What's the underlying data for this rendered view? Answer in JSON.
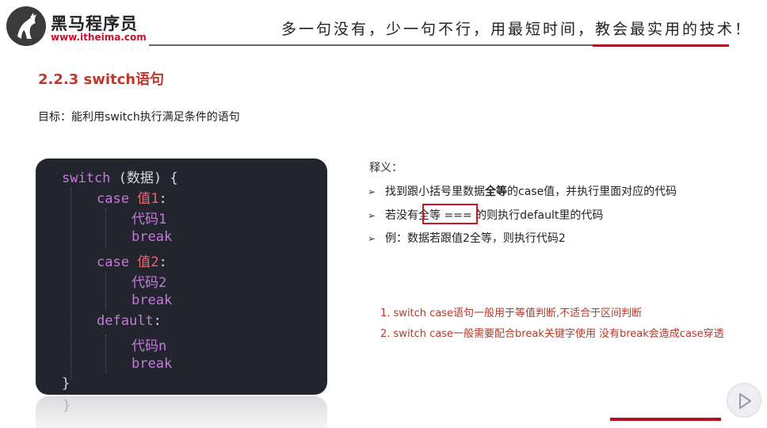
{
  "header": {
    "brand_name": "黑马程序员",
    "brand_url": "www.itheima.com",
    "slogan": "多一句没有，少一句不行，用最短时间，教会最实用的技术！",
    "accent_color": "#c8102e"
  },
  "section": {
    "title": "2.2.3  switch语句",
    "goal": "目标：能利用switch执行满足条件的语句"
  },
  "code": {
    "l1_kw": "switch",
    "l1_rest": " (数据) {",
    "l2_kw": "case",
    "l2_val": "值1",
    "l2_colon": ":",
    "l3": "代码1",
    "l4": "break",
    "l5_kw": "case",
    "l5_val": "值2",
    "l5_colon": ":",
    "l6": "代码2",
    "l7": "break",
    "l8_kw": "default",
    "l8_colon": ":",
    "l9": "代码n",
    "l10": "break",
    "l11": "}",
    "ghost": "}"
  },
  "explain": {
    "heading": "释义：",
    "b1_pre": "找到跟小括号里数据",
    "b1_bold": "全等",
    "b1_post": "的case值，并执行里面对应的代码",
    "b2_pre": "若没有",
    "b2_box": "全等 ===",
    "b2_post": " 的则执行default里的代码",
    "b3": "例：数据若跟值2全等，则执行代码2"
  },
  "notes": {
    "n1": "1. switch case语句一般用于等值判断,不适合于区间判断",
    "n2": "2. switch case一般需要配合break关键字使用 没有break会造成case穿透"
  },
  "icons": {
    "logo": "horse-logo-icon",
    "bullet": "arrow-bullet-icon",
    "play": "play-icon"
  }
}
